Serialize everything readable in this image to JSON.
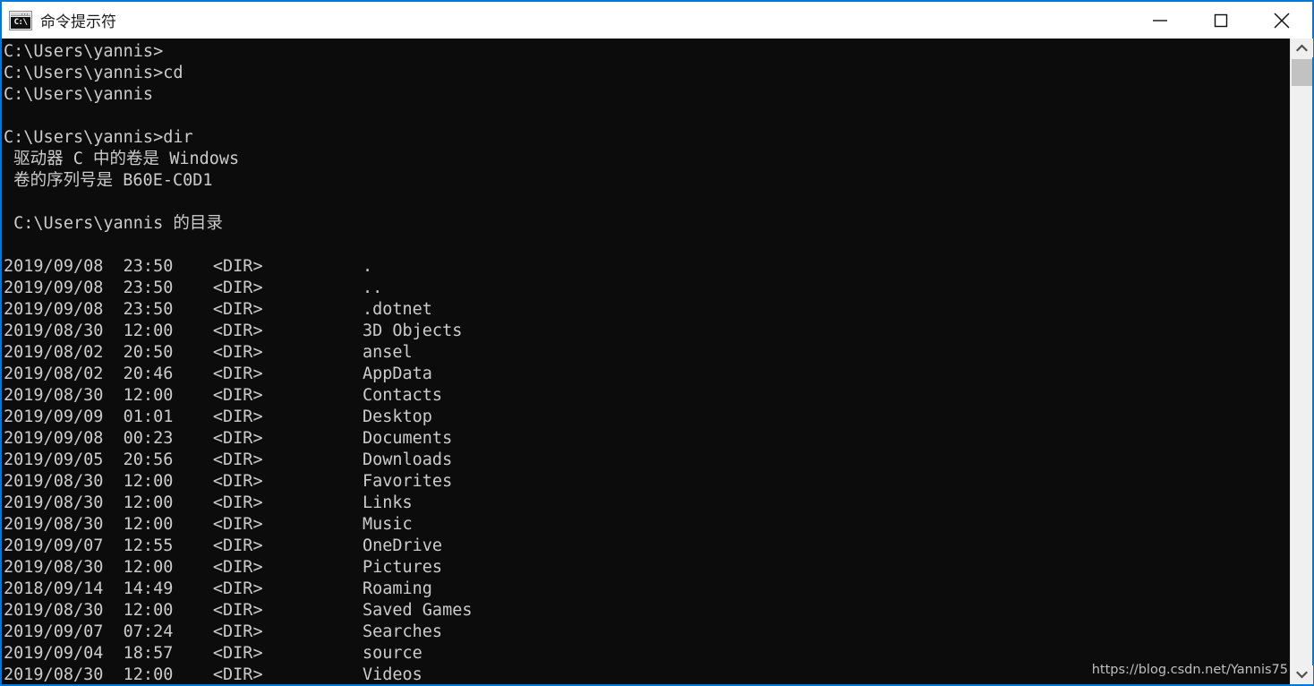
{
  "window": {
    "title": "命令提示符",
    "icon": "cmd-prompt-icon",
    "icon_glyph": "C:\\",
    "accent_color": "#0078d7",
    "background_color": "#0c0c0c",
    "text_color": "#cccccc",
    "controls": {
      "minimize": "最小化",
      "maximize": "最大化",
      "close": "关闭"
    }
  },
  "terminal": {
    "prompt_path": "C:\\Users\\yannis",
    "lines": [
      "C:\\Users\\yannis>",
      "C:\\Users\\yannis>cd",
      "C:\\Users\\yannis",
      "",
      "C:\\Users\\yannis>dir",
      " 驱动器 C 中的卷是 Windows",
      " 卷的序列号是 B60E-C0D1",
      "",
      " C:\\Users\\yannis 的目录",
      "",
      "2019/09/08  23:50    <DIR>          .",
      "2019/09/08  23:50    <DIR>          ..",
      "2019/09/08  23:50    <DIR>          .dotnet",
      "2019/08/30  12:00    <DIR>          3D Objects",
      "2019/08/02  20:50    <DIR>          ansel",
      "2019/08/02  20:46    <DIR>          AppData",
      "2019/08/30  12:00    <DIR>          Contacts",
      "2019/09/09  01:01    <DIR>          Desktop",
      "2019/09/08  00:23    <DIR>          Documents",
      "2019/09/05  20:56    <DIR>          Downloads",
      "2019/08/30  12:00    <DIR>          Favorites",
      "2019/08/30  12:00    <DIR>          Links",
      "2019/08/30  12:00    <DIR>          Music",
      "2019/09/07  12:55    <DIR>          OneDrive",
      "2019/08/30  12:00    <DIR>          Pictures",
      "2018/09/14  14:49    <DIR>          Roaming",
      "2019/08/30  12:00    <DIR>          Saved Games",
      "2019/09/07  07:24    <DIR>          Searches",
      "2019/09/04  18:57    <DIR>          source",
      "2019/08/30  12:00    <DIR>          Videos"
    ],
    "volume_label": "Windows",
    "volume_serial": "B60E-C0D1",
    "commands": [
      "cd",
      "dir"
    ],
    "entries": [
      {
        "date": "2019/09/08",
        "time": "23:50",
        "type": "<DIR>",
        "name": "."
      },
      {
        "date": "2019/09/08",
        "time": "23:50",
        "type": "<DIR>",
        "name": ".."
      },
      {
        "date": "2019/09/08",
        "time": "23:50",
        "type": "<DIR>",
        "name": ".dotnet"
      },
      {
        "date": "2019/08/30",
        "time": "12:00",
        "type": "<DIR>",
        "name": "3D Objects"
      },
      {
        "date": "2019/08/02",
        "time": "20:50",
        "type": "<DIR>",
        "name": "ansel"
      },
      {
        "date": "2019/08/02",
        "time": "20:46",
        "type": "<DIR>",
        "name": "AppData"
      },
      {
        "date": "2019/08/30",
        "time": "12:00",
        "type": "<DIR>",
        "name": "Contacts"
      },
      {
        "date": "2019/09/09",
        "time": "01:01",
        "type": "<DIR>",
        "name": "Desktop"
      },
      {
        "date": "2019/09/08",
        "time": "00:23",
        "type": "<DIR>",
        "name": "Documents"
      },
      {
        "date": "2019/09/05",
        "time": "20:56",
        "type": "<DIR>",
        "name": "Downloads"
      },
      {
        "date": "2019/08/30",
        "time": "12:00",
        "type": "<DIR>",
        "name": "Favorites"
      },
      {
        "date": "2019/08/30",
        "time": "12:00",
        "type": "<DIR>",
        "name": "Links"
      },
      {
        "date": "2019/08/30",
        "time": "12:00",
        "type": "<DIR>",
        "name": "Music"
      },
      {
        "date": "2019/09/07",
        "time": "12:55",
        "type": "<DIR>",
        "name": "OneDrive"
      },
      {
        "date": "2019/08/30",
        "time": "12:00",
        "type": "<DIR>",
        "name": "Pictures"
      },
      {
        "date": "2018/09/14",
        "time": "14:49",
        "type": "<DIR>",
        "name": "Roaming"
      },
      {
        "date": "2019/08/30",
        "time": "12:00",
        "type": "<DIR>",
        "name": "Saved Games"
      },
      {
        "date": "2019/09/07",
        "time": "07:24",
        "type": "<DIR>",
        "name": "Searches"
      },
      {
        "date": "2019/09/04",
        "time": "18:57",
        "type": "<DIR>",
        "name": "source"
      },
      {
        "date": "2019/08/30",
        "time": "12:00",
        "type": "<DIR>",
        "name": "Videos"
      }
    ]
  },
  "watermark": {
    "text": "https://blog.csdn.net/Yannis75"
  },
  "scrollbar": {
    "up_icon": "chevron-up-icon",
    "down_icon": "chevron-down-icon"
  }
}
